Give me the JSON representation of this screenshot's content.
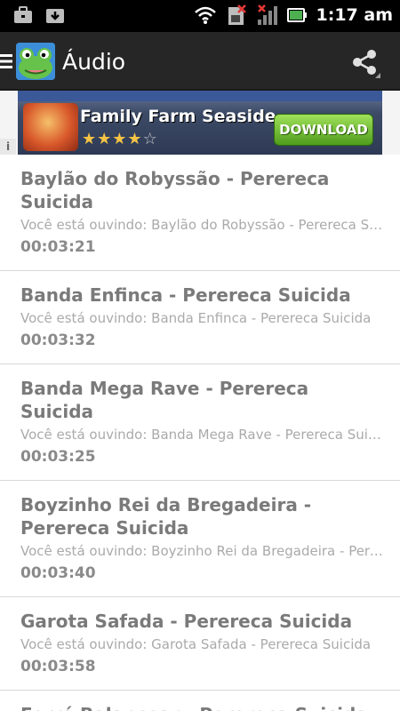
{
  "status_bar": {
    "time": "1:17 am",
    "icons": [
      "briefcase-icon",
      "download-icon",
      "wifi-icon",
      "no-sim-icon",
      "signal-icon",
      "battery-icon"
    ]
  },
  "action_bar": {
    "title": "Áudio",
    "icons": [
      "menu-icon",
      "frog-app-icon",
      "share-icon"
    ]
  },
  "ad": {
    "title": "Family Farm Seaside",
    "rating": 4,
    "max_rating": 5,
    "button_label": "DOWNLOAD",
    "info_label": "i"
  },
  "tracks": [
    {
      "title": "Baylão do Robyssão - Perereca Suicida",
      "subtitle": "Você está ouvindo: Baylão do Robyssão - Perereca Suicida",
      "duration": "00:03:21"
    },
    {
      "title": "Banda Enfinca - Perereca Suicida",
      "subtitle": "Você está ouvindo: Banda Enfinca - Perereca Suicida",
      "duration": "00:03:32"
    },
    {
      "title": "Banda Mega Rave - Perereca Suicida",
      "subtitle": "Você está ouvindo: Banda Mega Rave - Perereca Suicida",
      "duration": "00:03:25"
    },
    {
      "title": "Boyzinho Rei da Bregadeira - Perereca Suicida",
      "subtitle": "Você está ouvindo: Boyzinho Rei da Bregadeira - Perereca Suicida",
      "duration": "00:03:40"
    },
    {
      "title": "Garota Safada - Perereca Suicida",
      "subtitle": "Você está ouvindo: Garota Safada - Perereca Suicida",
      "duration": "00:03:58"
    },
    {
      "title": "Forró Balancear - Perereca Suicida",
      "subtitle": "",
      "duration": ""
    }
  ]
}
